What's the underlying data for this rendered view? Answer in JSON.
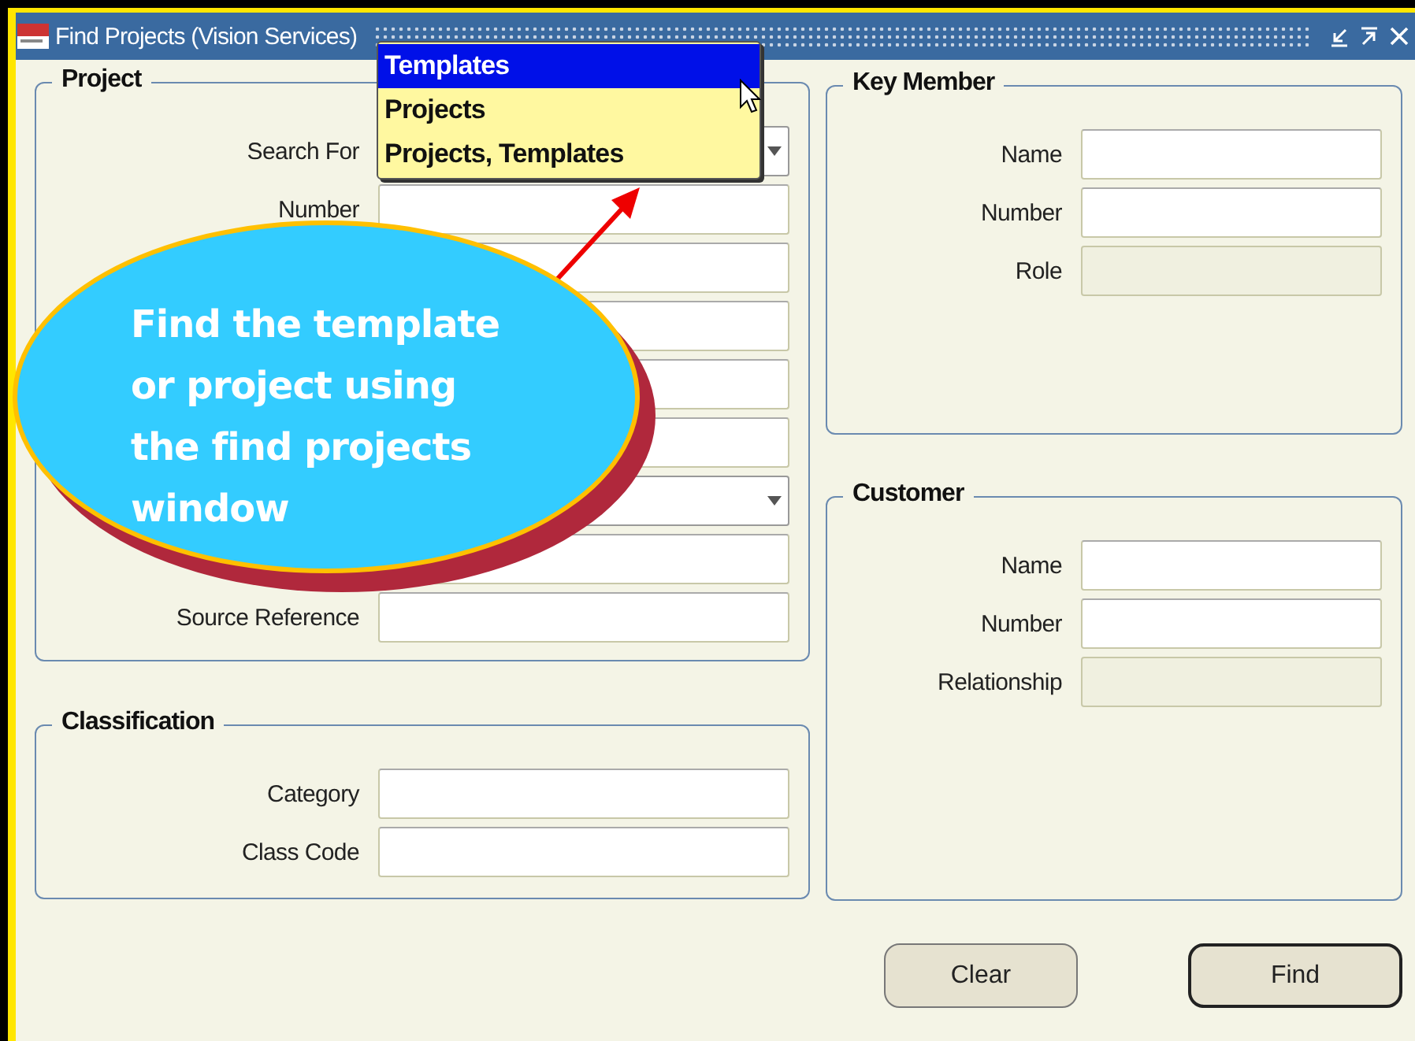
{
  "window": {
    "title": "Find Projects (Vision Services)"
  },
  "project": {
    "title": "Project",
    "fields": [
      {
        "label": "Search For",
        "kind": "select"
      },
      {
        "label": "Number",
        "kind": "text"
      },
      {
        "kind": "text"
      },
      {
        "kind": "text"
      },
      {
        "kind": "text"
      },
      {
        "kind": "text"
      },
      {
        "kind": "select"
      },
      {
        "kind": "text"
      },
      {
        "label": "Source Reference",
        "kind": "text"
      }
    ]
  },
  "classification": {
    "title": "Classification",
    "fields": [
      {
        "label": "Category",
        "kind": "text"
      },
      {
        "label": "Class Code",
        "kind": "text"
      }
    ]
  },
  "key_member": {
    "title": "Key Member",
    "fields": [
      {
        "label": "Name",
        "kind": "text",
        "disabled": false
      },
      {
        "label": "Number",
        "kind": "text",
        "disabled": false
      },
      {
        "label": "Role",
        "kind": "text",
        "disabled": true
      }
    ]
  },
  "customer": {
    "title": "Customer",
    "fields": [
      {
        "label": "Name",
        "kind": "text",
        "disabled": false
      },
      {
        "label": "Number",
        "kind": "text",
        "disabled": false
      },
      {
        "label": "Relationship",
        "kind": "text",
        "disabled": true
      }
    ]
  },
  "search_for_list": {
    "options": [
      {
        "label": "Templates",
        "selected": true
      },
      {
        "label": "Projects",
        "selected": false
      },
      {
        "label": "Projects, Templates",
        "selected": false
      }
    ]
  },
  "buttons": [
    {
      "label": "Clear",
      "default": false
    },
    {
      "label": "Find",
      "default": true
    }
  ],
  "callout": {
    "text": "Find the template or project using the find projects window"
  }
}
